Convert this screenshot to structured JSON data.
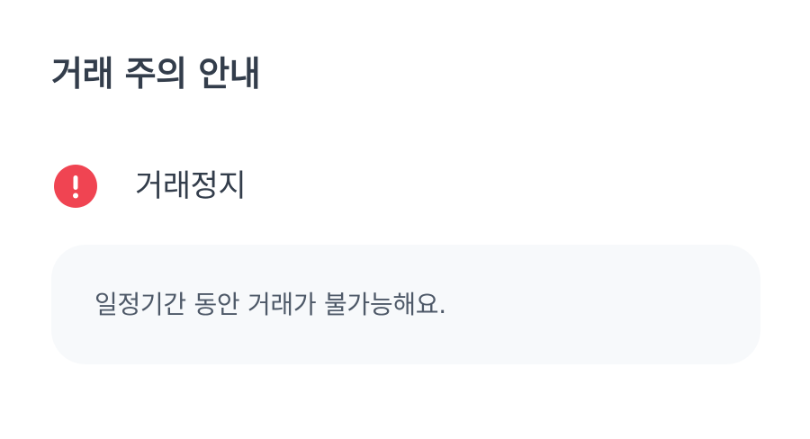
{
  "page": {
    "title": "거래 주의 안내"
  },
  "status": {
    "icon": "exclamation-circle-icon",
    "icon_color": "#f04452",
    "label": "거래정지"
  },
  "notice": {
    "text": "일정기간 동안 거래가 불가능해요."
  }
}
